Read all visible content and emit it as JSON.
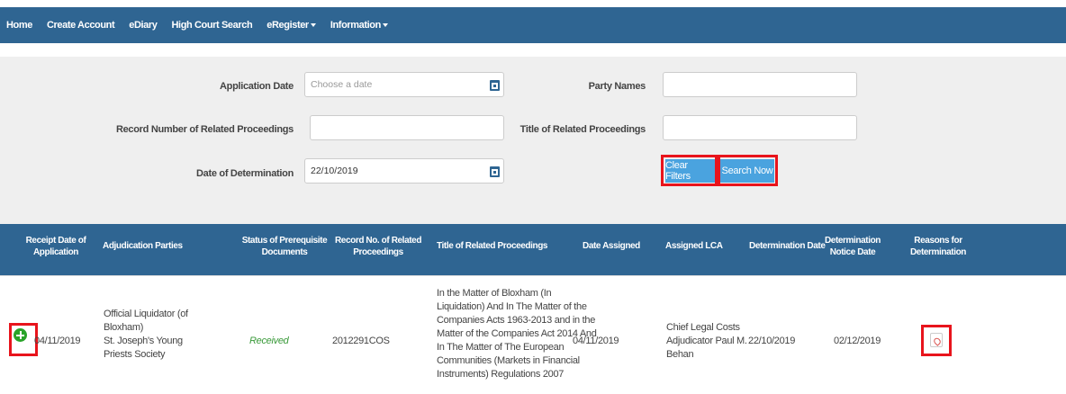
{
  "nav": {
    "home": "Home",
    "create_account": "Create Account",
    "ediary": "eDiary",
    "high_court_search": "High Court Search",
    "eregister": "eRegister",
    "information": "Information"
  },
  "filters": {
    "application_date_label": "Application Date",
    "application_date_placeholder": "Choose a date",
    "application_date_value": "",
    "party_names_label": "Party Names",
    "party_names_value": "",
    "record_number_label": "Record Number of Related Proceedings",
    "record_number_value": "",
    "title_label": "Title of Related Proceedings",
    "title_value": "",
    "determination_date_label": "Date of Determination",
    "determination_date_value": "22/10/2019",
    "clear_filters": "Clear Filters",
    "search_now": "Search Now"
  },
  "table": {
    "headers": {
      "receipt_1": "Receipt Date of",
      "receipt_2": "Application",
      "parties": "Adjudication Parties",
      "status_1": "Status of Prerequisite",
      "status_2": "Documents",
      "record_1": "Record No. of Related",
      "record_2": "Proceedings",
      "title": "Title of Related Proceedings",
      "date_assigned": "Date Assigned",
      "assigned_lca": "Assigned LCA",
      "determination_date": "Determination Date",
      "notice_1": "Determination",
      "notice_2": "Notice Date",
      "reasons_1": "Reasons for",
      "reasons_2": "Determination"
    },
    "row": {
      "receipt_date": "04/11/2019",
      "parties": [
        "Official Liquidator (of",
        "Bloxham)",
        "St. Joseph's Young",
        "Priests Society"
      ],
      "status": "Received",
      "record_no": "2012291COS",
      "title": [
        "In the Matter of Bloxham (In",
        "Liquidation) And In The Matter of the",
        "Companies Acts 1963-2013 and in the",
        "Matter of the Companies Act 2014 And",
        "In The Matter of The European",
        "Communities (Markets in Financial",
        "Instruments) Regulations 2007"
      ],
      "date_assigned": "04/11/2019",
      "assigned_lca": [
        "Chief Legal Costs",
        "Adjudicator Paul M.",
        "Behan"
      ],
      "determination_date": "22/10/2019",
      "notice_date": "02/12/2019"
    }
  },
  "colors": {
    "nav_bg": "#2f6592",
    "button_bg": "#4aa3df",
    "highlight": "#e8141c",
    "received": "#3a9a3a",
    "expand_icon": "#29a329"
  }
}
